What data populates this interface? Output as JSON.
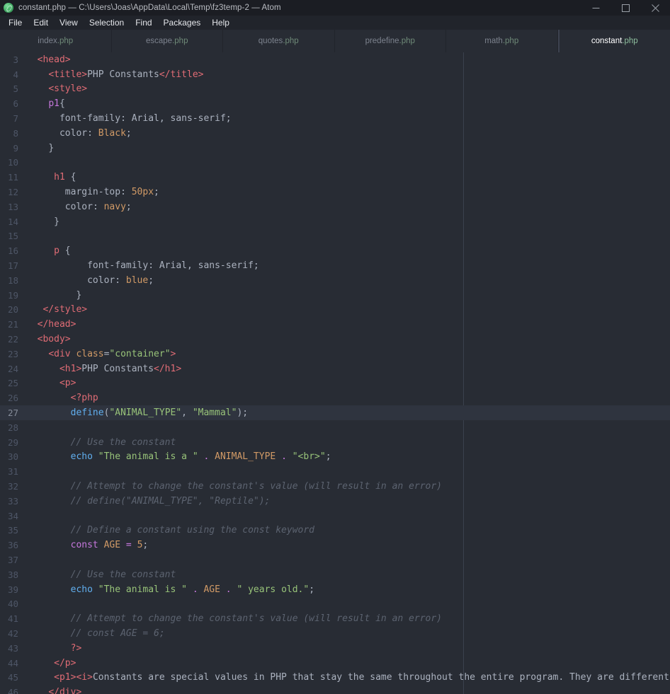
{
  "titlebar": {
    "title": "constant.php — C:\\Users\\Joas\\AppData\\Local\\Temp\\fz3temp-2 — Atom",
    "logo_icon": "atom-logo-icon",
    "minimize_label": "—",
    "maximize_label": "□",
    "close_label": "✕"
  },
  "menubar": {
    "items": [
      {
        "label": "File"
      },
      {
        "label": "Edit"
      },
      {
        "label": "View"
      },
      {
        "label": "Selection"
      },
      {
        "label": "Find"
      },
      {
        "label": "Packages"
      },
      {
        "label": "Help"
      }
    ]
  },
  "tabs": [
    {
      "name": "index",
      "ext": ".php",
      "active": false
    },
    {
      "name": "escape",
      "ext": ".php",
      "active": false
    },
    {
      "name": "quotes",
      "ext": ".php",
      "active": false
    },
    {
      "name": "predefine",
      "ext": ".php",
      "active": false
    },
    {
      "name": "math",
      "ext": ".php",
      "active": false
    },
    {
      "name": "constant",
      "ext": ".php",
      "active": true
    }
  ],
  "editor": {
    "active_line": 27,
    "wrap_guide_column": 654,
    "lines": [
      {
        "n": 3,
        "tokens": [
          {
            "t": "plain",
            "v": "  "
          },
          {
            "t": "tag",
            "v": "<head>"
          }
        ]
      },
      {
        "n": 4,
        "tokens": [
          {
            "t": "plain",
            "v": "    "
          },
          {
            "t": "tag",
            "v": "<title>"
          },
          {
            "t": "plain",
            "v": "PHP Constants"
          },
          {
            "t": "tag",
            "v": "</title>"
          }
        ]
      },
      {
        "n": 5,
        "tokens": [
          {
            "t": "plain",
            "v": "    "
          },
          {
            "t": "tag",
            "v": "<style>"
          }
        ]
      },
      {
        "n": 6,
        "tokens": [
          {
            "t": "plain",
            "v": "    "
          },
          {
            "t": "kw",
            "v": "p1"
          },
          {
            "t": "punc",
            "v": "{"
          }
        ]
      },
      {
        "n": 7,
        "tokens": [
          {
            "t": "plain",
            "v": "      "
          },
          {
            "t": "prop",
            "v": "font-family"
          },
          {
            "t": "punc",
            "v": ": "
          },
          {
            "t": "plain",
            "v": "Arial, sans-serif;"
          }
        ]
      },
      {
        "n": 8,
        "tokens": [
          {
            "t": "plain",
            "v": "      "
          },
          {
            "t": "prop",
            "v": "color"
          },
          {
            "t": "punc",
            "v": ": "
          },
          {
            "t": "val",
            "v": "Black"
          },
          {
            "t": "punc",
            "v": ";"
          }
        ]
      },
      {
        "n": 9,
        "tokens": [
          {
            "t": "plain",
            "v": "    "
          },
          {
            "t": "punc",
            "v": "}"
          }
        ]
      },
      {
        "n": 10,
        "tokens": []
      },
      {
        "n": 11,
        "tokens": [
          {
            "t": "plain",
            "v": "     "
          },
          {
            "t": "sel",
            "v": "h1"
          },
          {
            "t": "punc",
            "v": " {"
          }
        ]
      },
      {
        "n": 12,
        "tokens": [
          {
            "t": "plain",
            "v": "       "
          },
          {
            "t": "prop",
            "v": "margin-top"
          },
          {
            "t": "punc",
            "v": ": "
          },
          {
            "t": "num",
            "v": "50px"
          },
          {
            "t": "punc",
            "v": ";"
          }
        ]
      },
      {
        "n": 13,
        "tokens": [
          {
            "t": "plain",
            "v": "       "
          },
          {
            "t": "prop",
            "v": "color"
          },
          {
            "t": "punc",
            "v": ": "
          },
          {
            "t": "val",
            "v": "navy"
          },
          {
            "t": "punc",
            "v": ";"
          }
        ]
      },
      {
        "n": 14,
        "tokens": [
          {
            "t": "plain",
            "v": "     "
          },
          {
            "t": "punc",
            "v": "}"
          }
        ]
      },
      {
        "n": 15,
        "tokens": []
      },
      {
        "n": 16,
        "tokens": [
          {
            "t": "plain",
            "v": "     "
          },
          {
            "t": "sel",
            "v": "p"
          },
          {
            "t": "punc",
            "v": " {"
          }
        ]
      },
      {
        "n": 17,
        "tokens": [
          {
            "t": "plain",
            "v": "           "
          },
          {
            "t": "prop",
            "v": "font-family"
          },
          {
            "t": "punc",
            "v": ": "
          },
          {
            "t": "plain",
            "v": "Arial, sans-serif;"
          }
        ]
      },
      {
        "n": 18,
        "tokens": [
          {
            "t": "plain",
            "v": "           "
          },
          {
            "t": "prop",
            "v": "color"
          },
          {
            "t": "punc",
            "v": ": "
          },
          {
            "t": "val",
            "v": "blue"
          },
          {
            "t": "punc",
            "v": ";"
          }
        ]
      },
      {
        "n": 19,
        "tokens": [
          {
            "t": "plain",
            "v": "         "
          },
          {
            "t": "punc",
            "v": "}"
          }
        ]
      },
      {
        "n": 20,
        "tokens": [
          {
            "t": "plain",
            "v": "   "
          },
          {
            "t": "tag",
            "v": "</style>"
          }
        ]
      },
      {
        "n": 21,
        "tokens": [
          {
            "t": "plain",
            "v": "  "
          },
          {
            "t": "tag",
            "v": "</head>"
          }
        ]
      },
      {
        "n": 22,
        "tokens": [
          {
            "t": "plain",
            "v": "  "
          },
          {
            "t": "tag",
            "v": "<body>"
          }
        ]
      },
      {
        "n": 23,
        "tokens": [
          {
            "t": "plain",
            "v": "    "
          },
          {
            "t": "tag",
            "v": "<div "
          },
          {
            "t": "attr",
            "v": "class"
          },
          {
            "t": "punc",
            "v": "="
          },
          {
            "t": "str",
            "v": "\"container\""
          },
          {
            "t": "tag",
            "v": ">"
          }
        ]
      },
      {
        "n": 24,
        "tokens": [
          {
            "t": "plain",
            "v": "      "
          },
          {
            "t": "tag",
            "v": "<h1>"
          },
          {
            "t": "plain",
            "v": "PHP Constants"
          },
          {
            "t": "tag",
            "v": "</h1>"
          }
        ]
      },
      {
        "n": 25,
        "tokens": [
          {
            "t": "plain",
            "v": "      "
          },
          {
            "t": "tag",
            "v": "<p>"
          }
        ]
      },
      {
        "n": 26,
        "tokens": [
          {
            "t": "plain",
            "v": "        "
          },
          {
            "t": "php",
            "v": "<?php"
          }
        ]
      },
      {
        "n": 27,
        "tokens": [
          {
            "t": "plain",
            "v": "        "
          },
          {
            "t": "fn",
            "v": "define"
          },
          {
            "t": "punc",
            "v": "("
          },
          {
            "t": "str",
            "v": "\"ANIMAL_TYPE\""
          },
          {
            "t": "punc",
            "v": ", "
          },
          {
            "t": "str",
            "v": "\"Mammal\""
          },
          {
            "t": "punc",
            "v": ");"
          }
        ]
      },
      {
        "n": 28,
        "tokens": []
      },
      {
        "n": 29,
        "tokens": [
          {
            "t": "plain",
            "v": "        "
          },
          {
            "t": "cmt",
            "v": "// Use the constant"
          }
        ]
      },
      {
        "n": 30,
        "tokens": [
          {
            "t": "plain",
            "v": "        "
          },
          {
            "t": "fn",
            "v": "echo"
          },
          {
            "t": "punc",
            "v": " "
          },
          {
            "t": "str",
            "v": "\"The animal is a \""
          },
          {
            "t": "punc",
            "v": " "
          },
          {
            "t": "kw",
            "v": "."
          },
          {
            "t": "punc",
            "v": " "
          },
          {
            "t": "const",
            "v": "ANIMAL_TYPE"
          },
          {
            "t": "punc",
            "v": " "
          },
          {
            "t": "kw",
            "v": "."
          },
          {
            "t": "punc",
            "v": " "
          },
          {
            "t": "str",
            "v": "\"<br>\""
          },
          {
            "t": "punc",
            "v": ";"
          }
        ]
      },
      {
        "n": 31,
        "tokens": []
      },
      {
        "n": 32,
        "tokens": [
          {
            "t": "plain",
            "v": "        "
          },
          {
            "t": "cmt",
            "v": "// Attempt to change the constant's value (will result in an error)"
          }
        ]
      },
      {
        "n": 33,
        "tokens": [
          {
            "t": "plain",
            "v": "        "
          },
          {
            "t": "cmt",
            "v": "// define(\"ANIMAL_TYPE\", \"Reptile\");"
          }
        ]
      },
      {
        "n": 34,
        "tokens": []
      },
      {
        "n": 35,
        "tokens": [
          {
            "t": "plain",
            "v": "        "
          },
          {
            "t": "cmt",
            "v": "// Define a constant using the const keyword"
          }
        ]
      },
      {
        "n": 36,
        "tokens": [
          {
            "t": "plain",
            "v": "        "
          },
          {
            "t": "kw",
            "v": "const"
          },
          {
            "t": "punc",
            "v": " "
          },
          {
            "t": "const",
            "v": "AGE"
          },
          {
            "t": "punc",
            "v": " "
          },
          {
            "t": "kw",
            "v": "="
          },
          {
            "t": "punc",
            "v": " "
          },
          {
            "t": "num",
            "v": "5"
          },
          {
            "t": "punc",
            "v": ";"
          }
        ]
      },
      {
        "n": 37,
        "tokens": []
      },
      {
        "n": 38,
        "tokens": [
          {
            "t": "plain",
            "v": "        "
          },
          {
            "t": "cmt",
            "v": "// Use the constant"
          }
        ]
      },
      {
        "n": 39,
        "tokens": [
          {
            "t": "plain",
            "v": "        "
          },
          {
            "t": "fn",
            "v": "echo"
          },
          {
            "t": "punc",
            "v": " "
          },
          {
            "t": "str",
            "v": "\"The animal is \""
          },
          {
            "t": "punc",
            "v": " "
          },
          {
            "t": "kw",
            "v": "."
          },
          {
            "t": "punc",
            "v": " "
          },
          {
            "t": "const",
            "v": "AGE"
          },
          {
            "t": "punc",
            "v": " "
          },
          {
            "t": "kw",
            "v": "."
          },
          {
            "t": "punc",
            "v": " "
          },
          {
            "t": "str",
            "v": "\" years old.\""
          },
          {
            "t": "punc",
            "v": ";"
          }
        ]
      },
      {
        "n": 40,
        "tokens": []
      },
      {
        "n": 41,
        "tokens": [
          {
            "t": "plain",
            "v": "        "
          },
          {
            "t": "cmt",
            "v": "// Attempt to change the constant's value (will result in an error)"
          }
        ]
      },
      {
        "n": 42,
        "tokens": [
          {
            "t": "plain",
            "v": "        "
          },
          {
            "t": "cmt",
            "v": "// const AGE = 6;"
          }
        ]
      },
      {
        "n": 43,
        "tokens": [
          {
            "t": "plain",
            "v": "        "
          },
          {
            "t": "php",
            "v": "?>"
          }
        ]
      },
      {
        "n": 44,
        "tokens": [
          {
            "t": "plain",
            "v": "     "
          },
          {
            "t": "tag",
            "v": "</p>"
          }
        ]
      },
      {
        "n": 45,
        "tokens": [
          {
            "t": "plain",
            "v": "     "
          },
          {
            "t": "tag",
            "v": "<p1>"
          },
          {
            "t": "tag",
            "v": "<i>"
          },
          {
            "t": "plain",
            "v": "Constants are special values in PHP that stay the same throughout the entire program. They are different from"
          }
        ]
      },
      {
        "n": 46,
        "tokens": [
          {
            "t": "plain",
            "v": "    "
          },
          {
            "t": "tag",
            "v": "</div>"
          }
        ]
      }
    ]
  }
}
